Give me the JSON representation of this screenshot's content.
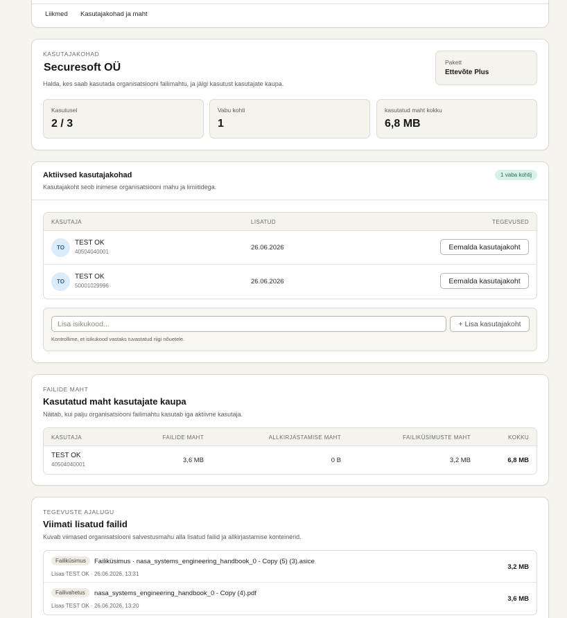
{
  "tabs": [
    "Liikmed",
    "Kasutajakohad ja maht"
  ],
  "seats": {
    "eyebrow": "KASUTAJAKOHAD",
    "title": "Securesoft OÜ",
    "description": "Halda, kes saab kasutada organisatsiooni failimahtu, ja jälgi kasutust kasutajate kaupa.",
    "package_label": "Pakett",
    "package_value": "Ettevõte Plus",
    "stats": [
      {
        "label": "Kasutusel",
        "value": "2 / 3"
      },
      {
        "label": "Vabu kohti",
        "value": "1"
      },
      {
        "label": "kasutatud maht kokku",
        "value": "6,8 MB"
      }
    ]
  },
  "active": {
    "title": "Aktiivsed kasutajakohad",
    "description": "Kasutajakoht seob inimese organisatsiooni mahu ja limiitidega.",
    "badge": "1 vaba kohtĳ",
    "columns": [
      "KASUTAJA",
      "LISATUD",
      "TEGEVUSED"
    ],
    "rows": [
      {
        "initials": "TO",
        "name": "TEST OK",
        "id": "40504040001",
        "added": "26.06.2026",
        "action": "Eemalda kasutajakoht"
      },
      {
        "initials": "TO",
        "name": "TEST OK",
        "id": "50001029996",
        "added": "26.06.2026",
        "action": "Eemalda kasutajakoht"
      }
    ],
    "input_placeholder": "Lisa isikukood...",
    "add_button": "+ Lisa kasutajakoht",
    "hint": "Kontrollime, et isikukood vastaks tuvastatud riigi nõuetele."
  },
  "storage": {
    "eyebrow": "FAILIDE MAHT",
    "title": "Kasutatud maht kasutajate kaupa",
    "description": "Näitab, kui palju organisatsiooni failimahtu kasutab iga aktiivne kasutaja.",
    "columns": [
      "KASUTAJA",
      "FAILIDE MAHT",
      "ALLKIRJASTAMISE MAHT",
      "FAILIKÜSIMUSTE MAHT",
      "KOKKU"
    ],
    "rows": [
      {
        "name": "TEST OK",
        "id": "40504040001",
        "files": "3,6 MB",
        "signing": "0 B",
        "requests": "3,2 MB",
        "total": "6,8 MB"
      }
    ]
  },
  "activity": {
    "eyebrow": "TEGEVUSTE AJALUGU",
    "title": "Viimati lisatud failid",
    "description": "Kuvab viimased organisatsiooni salvestusmahu alla lisatud failid ja allkirjastamise konteinerid.",
    "files": [
      {
        "tag": "Failiküsimus",
        "name": "Failiküsimus · nasa_systems_engineering_handbook_0 - Copy (5) (3).asice",
        "meta": "Lisas TEST OK · 26.06.2026, 13:31",
        "size": "3,2 MB"
      },
      {
        "tag": "Failivahetus",
        "name": "nasa_systems_engineering_handbook_0 - Copy (4).pdf",
        "meta": "Lisas TEST OK · 26.06.2026, 13:20",
        "size": "3,6 MB"
      }
    ]
  }
}
